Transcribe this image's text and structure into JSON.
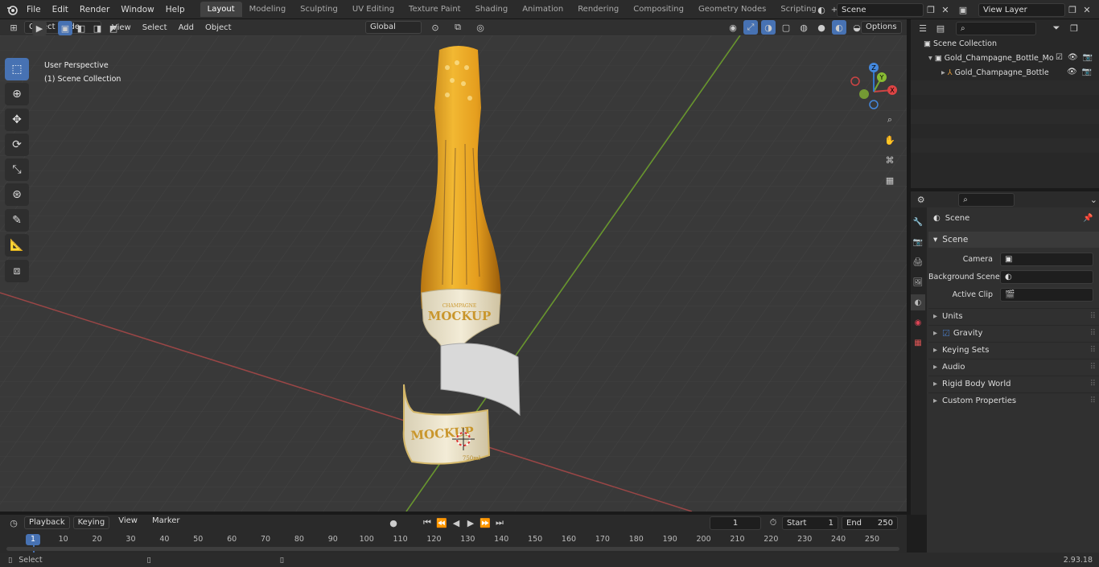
{
  "topbar": {
    "menus": [
      "File",
      "Edit",
      "Render",
      "Window",
      "Help"
    ],
    "workspace_tabs": [
      "Layout",
      "Modeling",
      "Sculpting",
      "UV Editing",
      "Texture Paint",
      "Shading",
      "Animation",
      "Rendering",
      "Compositing",
      "Geometry Nodes",
      "Scripting"
    ],
    "active_tab": "Layout",
    "add_tab_label": "+",
    "scene_name": "Scene",
    "view_layer_name": "View Layer"
  },
  "viewport_header": {
    "mode": "Object Mode",
    "menus": [
      "View",
      "Select",
      "Add",
      "Object"
    ],
    "orientation": "Global",
    "options_label": "Options"
  },
  "viewport": {
    "view_name": "User Perspective",
    "collection_label": "(1) Scene Collection",
    "label_text": "MOCKUP",
    "label_small": "CHAMPAGNE",
    "label_volume": "750ml",
    "gizmo": {
      "x": "X",
      "y": "Y",
      "z": "Z"
    }
  },
  "outliner": {
    "root": "Scene Collection",
    "items": [
      {
        "label": "Gold_Champagne_Bottle_Mo"
      },
      {
        "label": "Gold_Champagne_Bottle"
      }
    ]
  },
  "properties": {
    "context": "Scene",
    "panel": "Scene",
    "fields": [
      {
        "label": "Camera"
      },
      {
        "label": "Background Scene"
      },
      {
        "label": "Active Clip"
      }
    ],
    "subpanels": [
      "Units",
      "Gravity",
      "Keying Sets",
      "Audio",
      "Rigid Body World",
      "Custom Properties"
    ]
  },
  "timeline": {
    "menus": [
      "Playback",
      "Keying",
      "View",
      "Marker"
    ],
    "current_frame": "1",
    "start_label": "Start",
    "start_value": "1",
    "end_label": "End",
    "end_value": "250",
    "ticks": [
      "1",
      "10",
      "20",
      "30",
      "40",
      "50",
      "60",
      "70",
      "80",
      "90",
      "100",
      "110",
      "120",
      "130",
      "140",
      "150",
      "160",
      "170",
      "180",
      "190",
      "200",
      "210",
      "220",
      "230",
      "240",
      "250"
    ]
  },
  "statusbar": {
    "select_label": "Select",
    "version": "2.93.18"
  },
  "colors": {
    "accent": "#4772b3",
    "x_axis": "#b04848",
    "y_axis": "#6c9a2c",
    "gold": "#e5a722"
  }
}
